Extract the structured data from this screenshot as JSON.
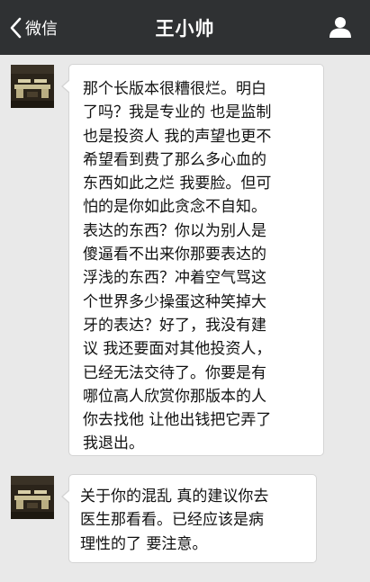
{
  "header": {
    "back_label": "微信",
    "title": "王小帅",
    "back_icon": "chevron-left-icon",
    "profile_icon": "person-icon"
  },
  "colors": {
    "header_bg": "#2f3133",
    "chat_bg": "#e9e9e9",
    "bubble_bg": "#ffffff"
  },
  "messages": [
    {
      "lines": [
        "那个长版本很糟很烂。明白",
        "了吗？我是专业的 也是监制",
        "也是投资人 我的声望也更不",
        "希望看到费了那么多心血的",
        "东西如此之烂 我要脸。但可",
        "怕的是你如此贪念不自知。",
        "表达的东西？你以为别人是",
        "傻逼看不出来你那要表达的",
        "浮浅的东西？冲着空气骂这",
        "个世界多少操蛋这种笑掉大",
        "牙的表达？好了，我没有建",
        "议 我还要面对其他投资人，",
        "已经无法交待了。你要是有",
        "哪位高人欣赏你那版本的人",
        "你去找他 让他出钱把它弄了",
        "我退出。"
      ]
    },
    {
      "lines": [
        "关于你的混乱 真的建议你去",
        "医生那看看。已经应该是病",
        "理性的了 要注意。"
      ]
    }
  ]
}
